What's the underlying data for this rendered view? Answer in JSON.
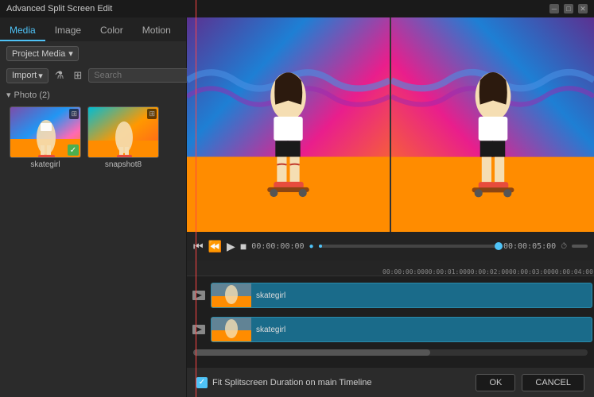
{
  "window": {
    "title": "Advanced Split Screen Edit"
  },
  "tabs": {
    "items": [
      {
        "id": "media",
        "label": "Media",
        "active": true
      },
      {
        "id": "image",
        "label": "Image",
        "active": false
      },
      {
        "id": "color",
        "label": "Color",
        "active": false
      },
      {
        "id": "motion",
        "label": "Motion",
        "active": false
      }
    ]
  },
  "toolbar": {
    "project_media_label": "Project Media",
    "import_label": "Import",
    "search_placeholder": "Search"
  },
  "media": {
    "section_label": "Photo (2)",
    "items": [
      {
        "id": "skategirl",
        "label": "skategirl",
        "has_check": true
      },
      {
        "id": "snapshot8",
        "label": "snapshot8",
        "has_check": false
      }
    ]
  },
  "playback": {
    "current_time": "00:00:00:00",
    "end_time": "00:00:05:00"
  },
  "timeline": {
    "ruler_marks": [
      "00:00:00:00",
      "00:00:01:00",
      "00:00:02:00",
      "00:00:03:00",
      "00:00:04:00",
      ""
    ],
    "tracks": [
      {
        "id": "track1",
        "label": "skategirl"
      },
      {
        "id": "track2",
        "label": "skategirl"
      }
    ]
  },
  "footer": {
    "fit_label": "Fit Splitscreen Duration on main Timeline",
    "ok_label": "OK",
    "cancel_label": "CANCEL"
  }
}
